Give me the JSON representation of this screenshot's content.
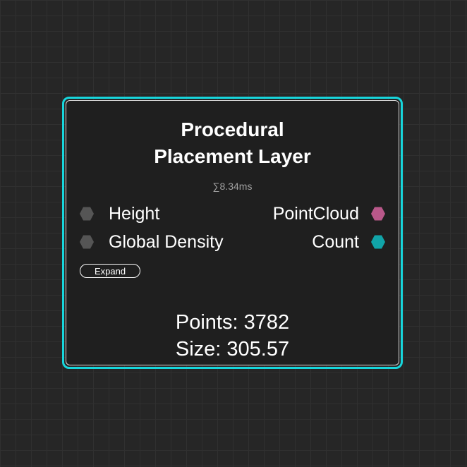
{
  "node": {
    "title_line1": "Procedural",
    "title_line2": "Placement Layer",
    "timing": "∑8.34ms",
    "border_color": "#17d6dc",
    "inputs": [
      {
        "label": "Height",
        "color": "#555555"
      },
      {
        "label": "Global Density",
        "color": "#555555"
      }
    ],
    "outputs": [
      {
        "label": "PointCloud",
        "color": "#b9588a"
      },
      {
        "label": "Count",
        "color": "#11a4a8"
      }
    ],
    "expand_label": "Expand",
    "stats": {
      "points": "Points: 3782",
      "size": "Size: 305.57"
    }
  }
}
